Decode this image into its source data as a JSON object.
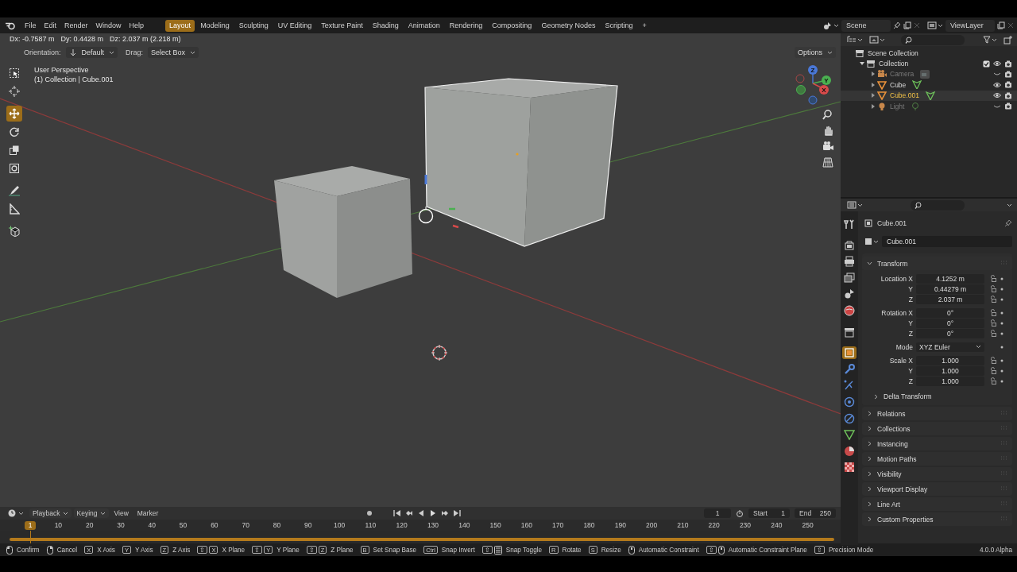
{
  "topbar": {
    "menus": [
      "File",
      "Edit",
      "Render",
      "Window",
      "Help"
    ],
    "workspaces": [
      {
        "label": "Layout",
        "selected": true
      },
      {
        "label": "Modeling",
        "selected": false
      },
      {
        "label": "Sculpting",
        "selected": false
      },
      {
        "label": "UV Editing",
        "selected": false
      },
      {
        "label": "Texture Paint",
        "selected": false
      },
      {
        "label": "Shading",
        "selected": false
      },
      {
        "label": "Animation",
        "selected": false
      },
      {
        "label": "Rendering",
        "selected": false
      },
      {
        "label": "Compositing",
        "selected": false
      },
      {
        "label": "Geometry Nodes",
        "selected": false
      },
      {
        "label": "Scripting",
        "selected": false
      }
    ],
    "add_workspace": "+",
    "scene": "Scene",
    "view_layer": "ViewLayer"
  },
  "viewport": {
    "readouts": [
      "Dx: -0.7587 m",
      "Dy: 0.4428 m",
      "Dz: 2.037 m (2.218 m)"
    ],
    "orientation_label": "Orientation:",
    "orientation": "Default",
    "drag_label": "Drag:",
    "drag": "Select Box",
    "options": "Options",
    "view_name": "User Perspective",
    "object_info": "(1) Collection | Cube.001",
    "tools": [
      {
        "kind": "select-box",
        "selected": false
      },
      {
        "kind": "cursor",
        "selected": false
      },
      {
        "kind": "move",
        "selected": true
      },
      {
        "kind": "rotate",
        "selected": false
      },
      {
        "kind": "scale",
        "selected": false
      },
      {
        "kind": "transform",
        "selected": false
      },
      {
        "kind": "annotate",
        "selected": false
      },
      {
        "kind": "measure",
        "selected": false
      },
      {
        "kind": "add-cube",
        "selected": false
      }
    ],
    "gizmo": {
      "z": "Z",
      "y": "Y",
      "x": "X"
    }
  },
  "outliner": {
    "tree": [
      {
        "name": "Scene Collection",
        "kind": "scene-collection",
        "children": [
          {
            "name": "Collection",
            "kind": "collection",
            "expanded": true,
            "checked": true,
            "visible": true,
            "children": [
              {
                "name": "Camera",
                "kind": "camera",
                "expanded": false,
                "visible": false,
                "selected": false
              },
              {
                "name": "Cube",
                "kind": "mesh",
                "expanded": false,
                "visible": true,
                "selected": false
              },
              {
                "name": "Cube.001",
                "kind": "mesh",
                "expanded": false,
                "visible": true,
                "selected": true
              },
              {
                "name": "Light",
                "kind": "light",
                "expanded": false,
                "visible": false,
                "selected": false
              }
            ]
          }
        ]
      }
    ]
  },
  "properties": {
    "tabs": [
      {
        "kind": "tool",
        "selected": false
      },
      {
        "kind": "render",
        "selected": false
      },
      {
        "kind": "output",
        "selected": false
      },
      {
        "kind": "view-layer",
        "selected": false
      },
      {
        "kind": "scene",
        "selected": false
      },
      {
        "kind": "world",
        "selected": false
      },
      {
        "kind": "collection",
        "selected": false
      },
      {
        "kind": "object",
        "selected": true
      },
      {
        "kind": "modifier",
        "selected": false
      },
      {
        "kind": "particles",
        "selected": false
      },
      {
        "kind": "physics",
        "selected": false
      },
      {
        "kind": "constraints",
        "selected": false
      },
      {
        "kind": "data",
        "selected": false
      },
      {
        "kind": "material",
        "selected": false
      },
      {
        "kind": "texture",
        "selected": false
      }
    ],
    "object_name": "Cube.001",
    "object_field": "Cube.001",
    "transform": {
      "title": "Transform",
      "expanded": true,
      "groups": [
        {
          "rows": [
            {
              "label": "Location X",
              "value": "4.1252 m",
              "kind": "number"
            },
            {
              "label": "Y",
              "value": "0.44279 m",
              "kind": "number"
            },
            {
              "label": "Z",
              "value": "2.037 m",
              "kind": "number"
            }
          ]
        },
        {
          "rows": [
            {
              "label": "Rotation X",
              "value": "0°",
              "kind": "number"
            },
            {
              "label": "Y",
              "value": "0°",
              "kind": "number"
            },
            {
              "label": "Z",
              "value": "0°",
              "kind": "number"
            }
          ]
        },
        {
          "rows": [
            {
              "label": "Mode",
              "value": "XYZ Euler",
              "kind": "dropdown"
            }
          ]
        },
        {
          "rows": [
            {
              "label": "Scale X",
              "value": "1.000",
              "kind": "number"
            },
            {
              "label": "Y",
              "value": "1.000",
              "kind": "number"
            },
            {
              "label": "Z",
              "value": "1.000",
              "kind": "number"
            }
          ]
        }
      ],
      "subpanels": [
        {
          "title": "Delta Transform",
          "expanded": false
        }
      ]
    },
    "panels": [
      {
        "title": "Relations",
        "expanded": false
      },
      {
        "title": "Collections",
        "expanded": false
      },
      {
        "title": "Instancing",
        "expanded": false
      },
      {
        "title": "Motion Paths",
        "expanded": false
      },
      {
        "title": "Visibility",
        "expanded": false
      },
      {
        "title": "Viewport Display",
        "expanded": false
      },
      {
        "title": "Line Art",
        "expanded": false
      },
      {
        "title": "Custom Properties",
        "expanded": false
      }
    ]
  },
  "timeline": {
    "menus": [
      "Playback",
      "Keying",
      "View",
      "Marker"
    ],
    "current_frame": "1",
    "start_label": "Start",
    "start": "1",
    "end_label": "End",
    "end": "250",
    "ruler": [
      {
        "label": "1",
        "selected": true
      },
      {
        "label": "10",
        "selected": false
      },
      {
        "label": "20",
        "selected": false
      },
      {
        "label": "30",
        "selected": false
      },
      {
        "label": "40",
        "selected": false
      },
      {
        "label": "50",
        "selected": false
      },
      {
        "label": "60",
        "selected": false
      },
      {
        "label": "70",
        "selected": false
      },
      {
        "label": "80",
        "selected": false
      },
      {
        "label": "90",
        "selected": false
      },
      {
        "label": "100",
        "selected": false
      },
      {
        "label": "110",
        "selected": false
      },
      {
        "label": "120",
        "selected": false
      },
      {
        "label": "130",
        "selected": false
      },
      {
        "label": "140",
        "selected": false
      },
      {
        "label": "150",
        "selected": false
      },
      {
        "label": "160",
        "selected": false
      },
      {
        "label": "170",
        "selected": false
      },
      {
        "label": "180",
        "selected": false
      },
      {
        "label": "190",
        "selected": false
      },
      {
        "label": "200",
        "selected": false
      },
      {
        "label": "210",
        "selected": false
      },
      {
        "label": "220",
        "selected": false
      },
      {
        "label": "230",
        "selected": false
      },
      {
        "label": "240",
        "selected": false
      },
      {
        "label": "250",
        "selected": false
      }
    ]
  },
  "status_bar": {
    "hints": [
      {
        "keys": [
          {
            "kind": "mouse-left"
          }
        ],
        "label": "Confirm"
      },
      {
        "keys": [
          {
            "kind": "mouse-right"
          }
        ],
        "label": "Cancel"
      },
      {
        "keys": [
          {
            "kind": "key",
            "label": "X"
          }
        ],
        "label": "X Axis"
      },
      {
        "keys": [
          {
            "kind": "key",
            "label": "Y"
          }
        ],
        "label": "Y Axis"
      },
      {
        "keys": [
          {
            "kind": "key",
            "label": "Z"
          }
        ],
        "label": "Z Axis"
      },
      {
        "keys": [
          {
            "kind": "key",
            "label": "⇧"
          },
          {
            "kind": "key",
            "label": "X"
          }
        ],
        "label": "X Plane"
      },
      {
        "keys": [
          {
            "kind": "key",
            "label": "⇧"
          },
          {
            "kind": "key",
            "label": "Y"
          }
        ],
        "label": "Y Plane"
      },
      {
        "keys": [
          {
            "kind": "key",
            "label": "⇧"
          },
          {
            "kind": "key",
            "label": "Z"
          }
        ],
        "label": "Z Plane"
      },
      {
        "keys": [
          {
            "kind": "key",
            "label": "B"
          }
        ],
        "label": "Set Snap Base"
      },
      {
        "keys": [
          {
            "kind": "key",
            "label": "Ctrl"
          }
        ],
        "label": "Snap Invert"
      },
      {
        "keys": [
          {
            "kind": "key",
            "label": "⇧"
          },
          {
            "kind": "snap"
          }
        ],
        "label": "Snap Toggle"
      },
      {
        "keys": [
          {
            "kind": "key",
            "label": "R"
          }
        ],
        "label": "Rotate"
      },
      {
        "keys": [
          {
            "kind": "key",
            "label": "S"
          }
        ],
        "label": "Resize"
      },
      {
        "keys": [
          {
            "kind": "mouse-middle"
          }
        ],
        "label": "Automatic Constraint"
      },
      {
        "keys": [
          {
            "kind": "key",
            "label": "⇧"
          },
          {
            "kind": "mouse-middle"
          }
        ],
        "label": "Automatic Constraint Plane"
      },
      {
        "keys": [
          {
            "kind": "key",
            "label": "⇧"
          }
        ],
        "label": "Precision Mode"
      }
    ],
    "version": "4.0.0 Alpha"
  }
}
